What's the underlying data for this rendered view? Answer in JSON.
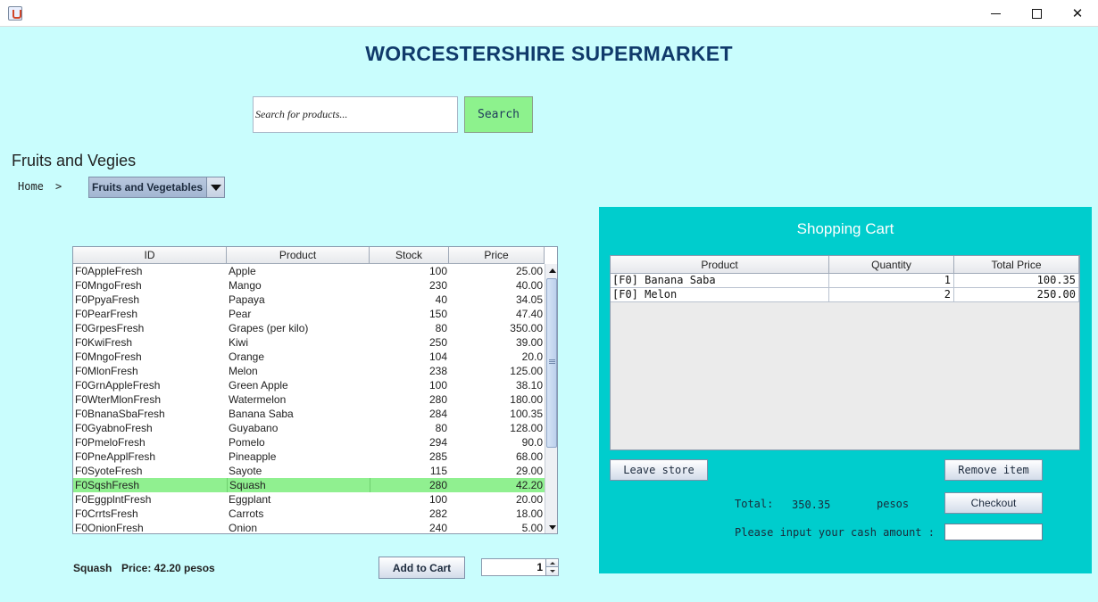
{
  "app": {
    "store_title": "WORCESTERSHIRE SUPERMARKET"
  },
  "search": {
    "placeholder": "Search for products...",
    "button_label": "Search"
  },
  "category": {
    "heading": "Fruits and Vegies",
    "breadcrumb_home": "Home",
    "breadcrumb_separator": ">",
    "selected": "Fruits and Vegetables"
  },
  "products": {
    "columns": [
      "ID",
      "Product",
      "Stock",
      "Price"
    ],
    "rows": [
      {
        "id": "F0AppleFresh",
        "product": "Apple",
        "stock": "100",
        "price": "25.00"
      },
      {
        "id": "F0MngoFresh",
        "product": "Mango",
        "stock": "230",
        "price": "40.00"
      },
      {
        "id": "F0PpyaFresh",
        "product": "Papaya",
        "stock": "40",
        "price": "34.05"
      },
      {
        "id": "F0PearFresh",
        "product": "Pear",
        "stock": "150",
        "price": "47.40"
      },
      {
        "id": "F0GrpesFresh",
        "product": "Grapes (per kilo)",
        "stock": "80",
        "price": "350.00"
      },
      {
        "id": "F0KwiFresh",
        "product": "Kiwi",
        "stock": "250",
        "price": "39.00"
      },
      {
        "id": "F0MngoFresh",
        "product": "Orange",
        "stock": "104",
        "price": "20.0"
      },
      {
        "id": "F0MlonFresh",
        "product": "Melon",
        "stock": "238",
        "price": "125.00"
      },
      {
        "id": "F0GrnAppleFresh",
        "product": "Green Apple",
        "stock": "100",
        "price": "38.10"
      },
      {
        "id": "F0WterMlonFresh",
        "product": "Watermelon",
        "stock": "280",
        "price": "180.00"
      },
      {
        "id": "F0BnanaSbaFresh",
        "product": "Banana Saba",
        "stock": "284",
        "price": "100.35"
      },
      {
        "id": "F0GyabnoFresh",
        "product": "Guyabano",
        "stock": "80",
        "price": "128.00"
      },
      {
        "id": "F0PmeloFresh",
        "product": "Pomelo",
        "stock": "294",
        "price": "90.0"
      },
      {
        "id": "F0PneApplFresh",
        "product": "Pineapple",
        "stock": "285",
        "price": "68.00"
      },
      {
        "id": "F0SyoteFresh",
        "product": "Sayote",
        "stock": "115",
        "price": "29.00"
      },
      {
        "id": "F0SqshFresh",
        "product": "Squash",
        "stock": "280",
        "price": "42.20",
        "selected": true
      },
      {
        "id": "F0EggplntFresh",
        "product": "Eggplant",
        "stock": "100",
        "price": "20.00"
      },
      {
        "id": "F0CrrtsFresh",
        "product": "Carrots",
        "stock": "282",
        "price": "18.00"
      },
      {
        "id": "F0OnionFresh",
        "product": "Onion",
        "stock": "240",
        "price": "5.00"
      }
    ],
    "selected_color": "#90f090"
  },
  "selection": {
    "name": "Squash",
    "price_text": "Price: 42.20 pesos",
    "add_to_cart_label": "Add to Cart",
    "quantity": "1"
  },
  "cart": {
    "title": "Shopping Cart",
    "columns": [
      "Product",
      "Quantity",
      "Total Price"
    ],
    "rows": [
      {
        "product": "[F0] Banana Saba",
        "quantity": "1",
        "total": "100.35"
      },
      {
        "product": "[F0] Melon",
        "quantity": "2",
        "total": "250.00"
      }
    ],
    "leave_label": "Leave store",
    "remove_label": "Remove item",
    "total_label": "Total:",
    "total_value": "350.35",
    "currency_label": "pesos",
    "checkout_label": "Checkout",
    "cash_prompt": "Please input your cash amount :",
    "panel_color": "#00cdcd"
  },
  "colors": {
    "background": "#c9fdfd",
    "title": "#103a6b",
    "search_button": "#8df28d"
  }
}
